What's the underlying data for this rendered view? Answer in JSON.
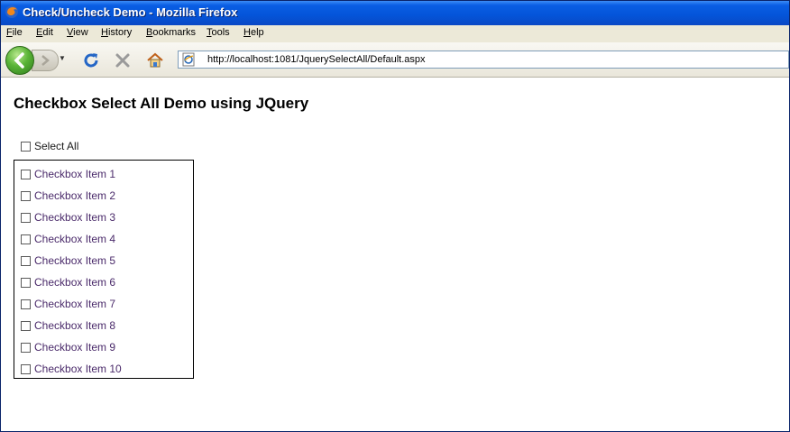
{
  "window": {
    "title": "Check/Uncheck Demo - Mozilla Firefox"
  },
  "menu": [
    "File",
    "Edit",
    "View",
    "History",
    "Bookmarks",
    "Tools",
    "Help"
  ],
  "address": {
    "url": "http://localhost:1081/JquerySelectAll/Default.aspx"
  },
  "page": {
    "heading": "Checkbox Select All Demo using JQuery",
    "select_all_label": "Select All",
    "select_all_checked": false,
    "items": [
      "Checkbox Item 1",
      "Checkbox Item 2",
      "Checkbox Item 3",
      "Checkbox Item 4",
      "Checkbox Item 5",
      "Checkbox Item 6",
      "Checkbox Item 7",
      "Checkbox Item 8",
      "Checkbox Item 9",
      "Checkbox Item 10"
    ],
    "items_checked": false
  },
  "colors": {
    "title_bar": "#0454d9",
    "item_text": "#4a2a6a"
  }
}
